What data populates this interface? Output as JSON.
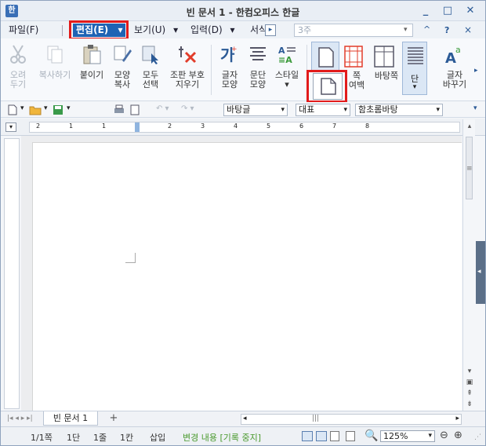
{
  "window": {
    "title": "빈 문서 1 - 한컴오피스 한글",
    "app_icon": "hwp-app-icon",
    "minimize_glyph": "_",
    "maximize_glyph": "□",
    "close_glyph": "✕",
    "help_glyph": "?",
    "collapse_glyph": "^",
    "close_small_glyph": "×"
  },
  "menubar": {
    "file": "파일(F)",
    "edit": "편집(E)",
    "edit_arrow": "▾",
    "view": "보기(U)",
    "view_arrow": "▾",
    "input": "입력(D)",
    "input_arrow": "▾",
    "format": "서식",
    "more_glyph": "▸",
    "search_value": "3주"
  },
  "ribbon": {
    "cut": [
      "오려",
      "두기"
    ],
    "copy": "복사하기",
    "paste": "붙이기",
    "format_copy": [
      "모양",
      "복사"
    ],
    "select_all": [
      "모두",
      "선택"
    ],
    "clear_format": [
      "조판 부호",
      "지우기"
    ],
    "char_shape": [
      "글자",
      "모양"
    ],
    "para_shape": [
      "문단",
      "모양"
    ],
    "style": "스타일",
    "page_margin": [
      "쪽",
      "여백"
    ],
    "background": "바탕쪽",
    "columns": "단",
    "change_char": [
      "글자",
      "바꾸기"
    ]
  },
  "toolbar2": {
    "style_combo": "바탕글",
    "lang_combo": "대표",
    "font_combo": "함초롬바탕",
    "combo_arrow": "▾"
  },
  "ruler": {
    "labels": [
      "2",
      "1",
      "1",
      "2",
      "3",
      "4",
      "5",
      "6",
      "7",
      "8"
    ]
  },
  "tabs": {
    "doc_tab": "빈 문서 1",
    "add_tab": "+"
  },
  "status": {
    "page": "1/1쪽",
    "column": "1단",
    "line": "1줄",
    "col": "1칸",
    "insert": "삽입",
    "track_changes": "변경 내용 [기록 중지]",
    "zoom": "125%",
    "zoom_arrow": "▾",
    "zoom_out": "⊖",
    "zoom_in": "⊕"
  },
  "colors": {
    "accent": "#1f63b4",
    "highlight": "#e21b1b",
    "track_changes": "#4a9a2e"
  }
}
